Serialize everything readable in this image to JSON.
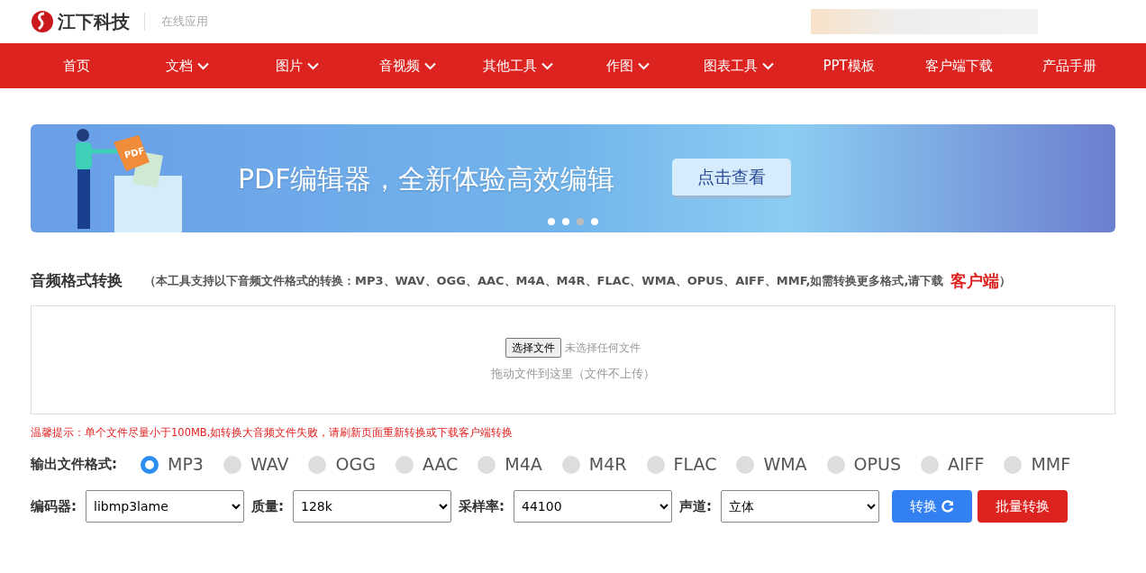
{
  "header": {
    "brand": "江下科技",
    "subtitle": "在线应用"
  },
  "nav": [
    {
      "label": "首页",
      "dropdown": false
    },
    {
      "label": "文档",
      "dropdown": true
    },
    {
      "label": "图片",
      "dropdown": true
    },
    {
      "label": "音视频",
      "dropdown": true
    },
    {
      "label": "其他工具",
      "dropdown": true
    },
    {
      "label": "作图",
      "dropdown": true
    },
    {
      "label": "图表工具",
      "dropdown": true
    },
    {
      "label": "PPT模板",
      "dropdown": false
    },
    {
      "label": "客户端下载",
      "dropdown": false
    },
    {
      "label": "产品手册",
      "dropdown": false
    }
  ],
  "banner": {
    "doc_label": "PDF",
    "headline": "PDF编辑器，全新体验高效编辑",
    "button": "点击查看",
    "dots": [
      {
        "selected": false
      },
      {
        "selected": false
      },
      {
        "selected": true
      },
      {
        "selected": false
      }
    ]
  },
  "tool": {
    "title": "音频格式转换",
    "description": "（本工具支持以下音频文件格式的转换：MP3、WAV、OGG、AAC、M4A、M4R、FLAC、WMA、OPUS、AIFF、MMF,如需转换更多格式,请下载",
    "client_link": "客户端",
    "description_end": "）"
  },
  "upload": {
    "button": "选择文件",
    "status": "未选择任何文件",
    "hint": "拖动文件到这里（文件不上传）"
  },
  "warning": "温馨提示：单个文件尽量小于100MB,如转换大音频文件失败，请刷新页面重新转换或下载客户端转换",
  "output_format": {
    "label": "输出文件格式:",
    "options": [
      {
        "label": "MP3",
        "selected": true
      },
      {
        "label": "WAV",
        "selected": false
      },
      {
        "label": "OGG",
        "selected": false
      },
      {
        "label": "AAC",
        "selected": false
      },
      {
        "label": "M4A",
        "selected": false
      },
      {
        "label": "M4R",
        "selected": false
      },
      {
        "label": "FLAC",
        "selected": false
      },
      {
        "label": "WMA",
        "selected": false
      },
      {
        "label": "OPUS",
        "selected": false
      },
      {
        "label": "AIFF",
        "selected": false
      },
      {
        "label": "MMF",
        "selected": false
      }
    ]
  },
  "settings": [
    {
      "label": "编码器:",
      "value": "libmp3lame"
    },
    {
      "label": "质量:",
      "value": "128k"
    },
    {
      "label": "采样率:",
      "value": "44100"
    },
    {
      "label": "声道:",
      "value": "立体"
    }
  ],
  "actions": [
    {
      "label": "转换",
      "kind": "primary",
      "icon": true
    },
    {
      "label": "批量转换",
      "kind": "danger",
      "icon": false
    }
  ]
}
